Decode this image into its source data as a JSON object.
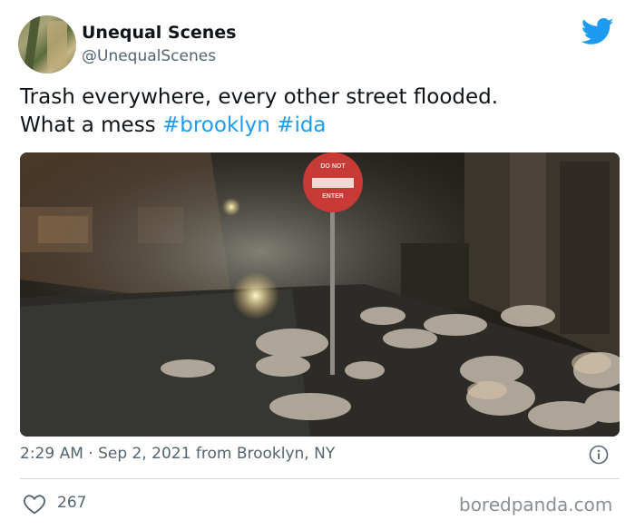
{
  "author": {
    "name": "Unequal Scenes",
    "handle": "@UnequalScenes"
  },
  "tweet": {
    "text_line1": "Trash everywhere, every other street flooded.",
    "text_line2_prefix": "What a mess ",
    "hashtags": [
      "#brooklyn",
      "#ida"
    ]
  },
  "photo": {
    "sign_line1": "DO NOT",
    "sign_line2": "ENTER"
  },
  "meta": {
    "time": "2:29 AM",
    "separator": " · ",
    "date": "Sep 2, 2021",
    "location": " from Brooklyn, NY"
  },
  "engagement": {
    "likes": "267"
  },
  "watermark": "boredpanda.com",
  "icons": {
    "platform": "twitter-bird-icon",
    "info": "info-icon",
    "like": "heart-icon"
  },
  "colors": {
    "link": "#1d9bf0",
    "secondary_text": "#536471",
    "primary_text": "#0f1419"
  }
}
